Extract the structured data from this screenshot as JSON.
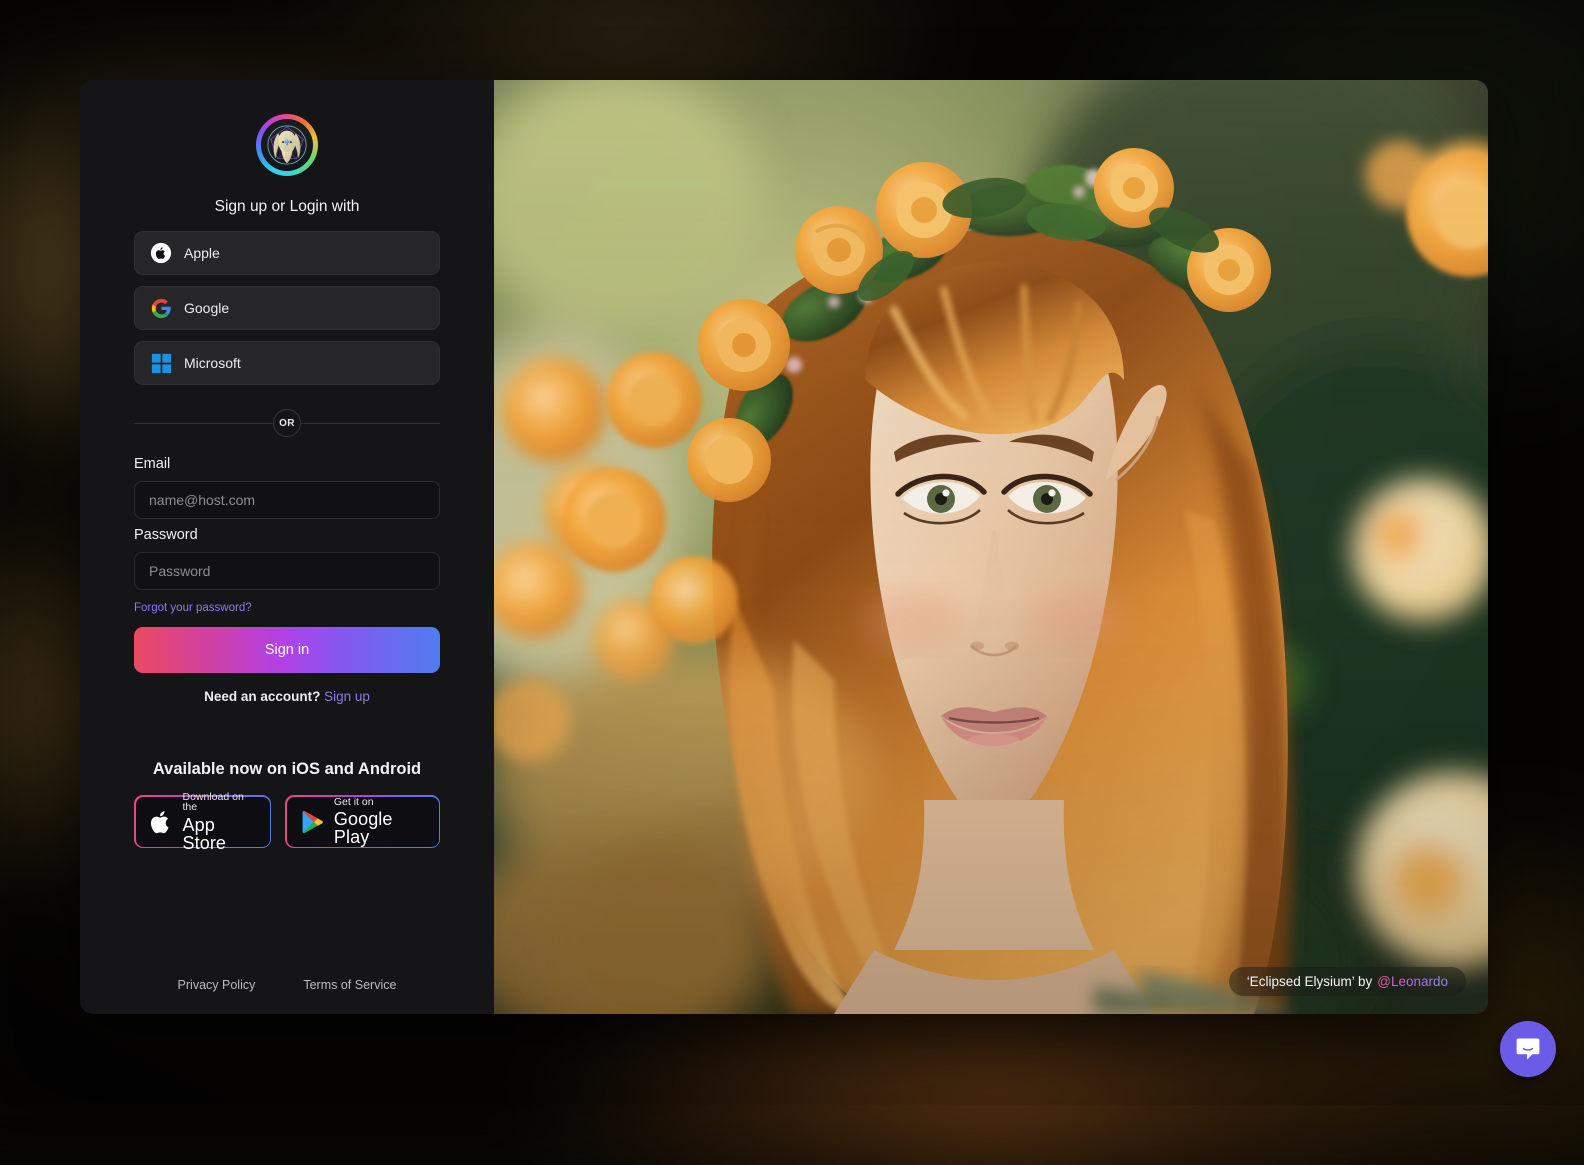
{
  "background": {
    "accent_warm": "#6b5526",
    "base": "#050403"
  },
  "card": {
    "panel_bg": "#151517"
  },
  "left_panel": {
    "logo_name": "leonardo-logo",
    "headline": "Sign up or Login with",
    "social_buttons": [
      {
        "label": "Apple",
        "icon": "apple-icon"
      },
      {
        "label": "Google",
        "icon": "google-icon"
      },
      {
        "label": "Microsoft",
        "icon": "microsoft-icon"
      }
    ],
    "divider_label": "OR",
    "email": {
      "label": "Email",
      "placeholder": "name@host.com",
      "value": ""
    },
    "password": {
      "label": "Password",
      "placeholder": "Password",
      "value": ""
    },
    "forgot_password": "Forgot your password?",
    "submit_label": "Sign in",
    "submit_gradient": "#ea4a5e → #b340e6 → #4f7df0",
    "need_account_text": "Need an account?",
    "signup_link": "Sign up",
    "store": {
      "title": "Available now on iOS and Android",
      "badges": [
        {
          "small": "Download on the",
          "big": "App Store",
          "icon": "apple-icon"
        },
        {
          "small": "Get it on",
          "big": "Google Play",
          "icon": "google-play-icon"
        }
      ]
    },
    "footer": [
      {
        "label": "Privacy Policy"
      },
      {
        "label": "Terms of Service"
      }
    ]
  },
  "image_panel": {
    "attribution_title": "‘Eclipsed Elysium’ by",
    "attribution_author": "@Leonardo"
  },
  "chat_widget": {
    "icon": "chat-bubble-icon",
    "color": "#6b5ce7"
  }
}
